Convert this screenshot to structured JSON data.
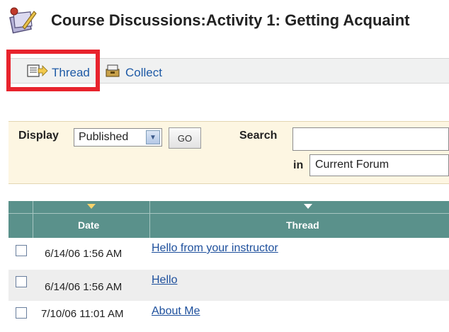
{
  "header": {
    "title": "Course Discussions:Activity 1: Getting Acquaint"
  },
  "toolbar": {
    "thread_label": "Thread",
    "collect_label": "Collect"
  },
  "filter": {
    "display_label": "Display",
    "display_value": "Published",
    "go_label": "GO",
    "search_label": "Search",
    "search_value": "",
    "in_label": "in",
    "scope_value": "Current Forum"
  },
  "table": {
    "columns": [
      "Date",
      "Thread"
    ],
    "rows": [
      {
        "date": "6/14/06 1:56 AM",
        "thread": "Hello from your instructor"
      },
      {
        "date": "6/14/06 1:56 AM",
        "thread": "Hello"
      },
      {
        "date": "7/10/06 11:01 AM",
        "thread": "About Me"
      }
    ]
  },
  "colors": {
    "header_bg": "#5a918b",
    "link": "#1d4f9c",
    "highlight": "#e8232d",
    "filter_bg": "#fdf6e2"
  }
}
